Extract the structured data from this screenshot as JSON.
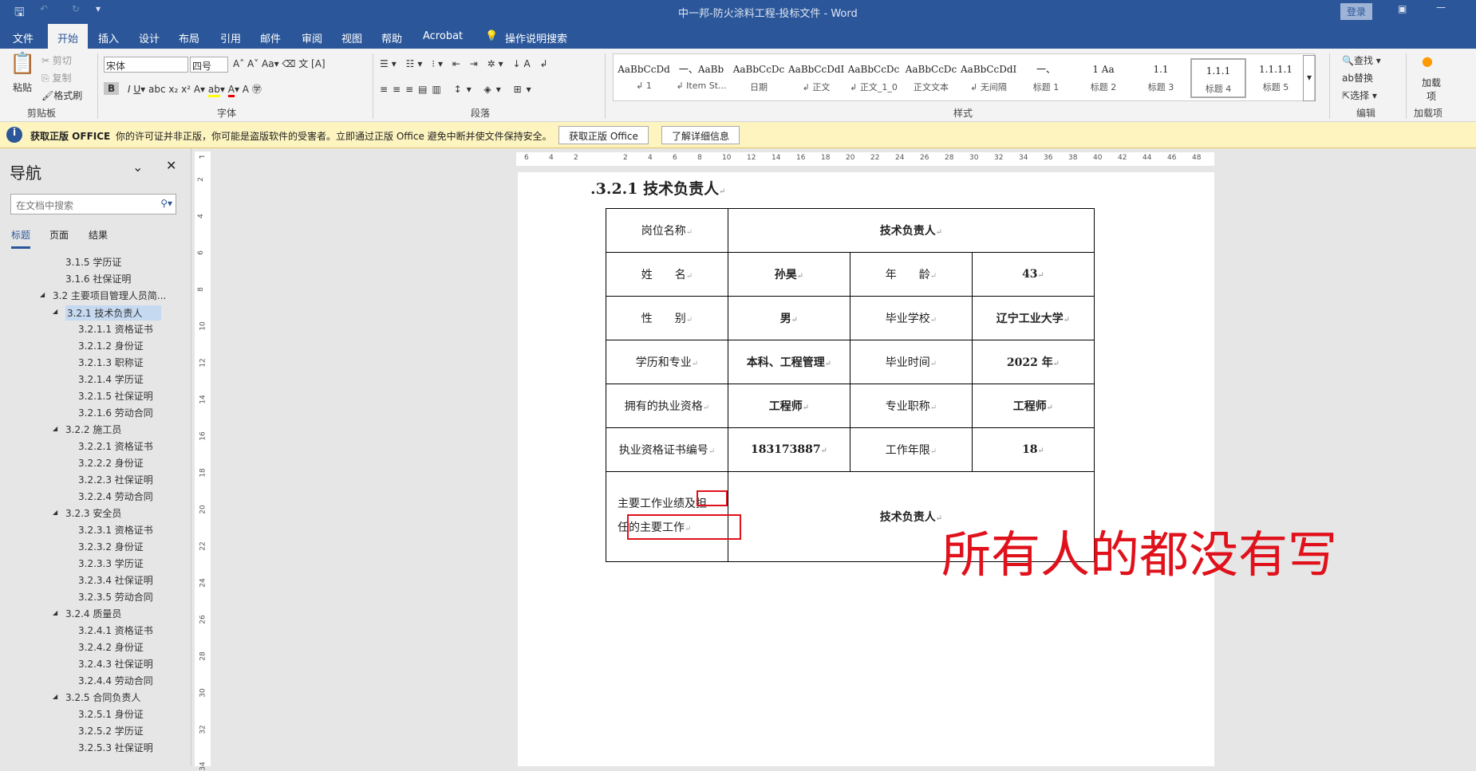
{
  "titlebar": {
    "title": "中一邦-防火涂料工程-投标文件  -  Word",
    "login": "登录"
  },
  "tabs": [
    "文件",
    "开始",
    "插入",
    "设计",
    "布局",
    "引用",
    "邮件",
    "审阅",
    "视图",
    "帮助",
    "Acrobat",
    "操作说明搜索"
  ],
  "ribbon": {
    "clipboard": {
      "paste": "粘贴",
      "cut": "剪切",
      "copy": "复制",
      "format_painter": "格式刷",
      "label": "剪贴板"
    },
    "font": {
      "name": "宋体",
      "size": "四号",
      "label": "字体"
    },
    "paragraph": {
      "label": "段落"
    },
    "styles": {
      "label": "样式",
      "items": [
        {
          "preview": "AaBbCcDd",
          "name": "↲ 1"
        },
        {
          "preview": "一、AaBb",
          "name": "↲ Item St..."
        },
        {
          "preview": "AaBbCcDc",
          "name": "日期"
        },
        {
          "preview": "AaBbCcDdI",
          "name": "↲ 正文"
        },
        {
          "preview": "AaBbCcDc",
          "name": "↲ 正文_1_0"
        },
        {
          "preview": "AaBbCcDc",
          "name": "正文文本"
        },
        {
          "preview": "AaBbCcDdI",
          "name": "↲ 无间隔"
        },
        {
          "preview": "一、",
          "name": "标题 1"
        },
        {
          "preview": "1  Aa",
          "name": "标题 2"
        },
        {
          "preview": "1.1",
          "name": "标题 3"
        },
        {
          "preview": "1.1.1",
          "name": "标题 4"
        },
        {
          "preview": "1.1.1.1",
          "name": "标题 5"
        }
      ]
    },
    "editing": {
      "find": "查找",
      "replace": "替换",
      "select": "选择",
      "label": "编辑"
    },
    "addins": {
      "button": "加载项",
      "label": "加载项"
    }
  },
  "infobar": {
    "title": "获取正版 OFFICE",
    "message": "你的许可证并非正版，你可能是盗版软件的受害者。立即通过正版 Office 避免中断并使文件保持安全。",
    "btn1": "获取正版 Office",
    "btn2": "了解详细信息"
  },
  "nav": {
    "title": "导航",
    "search_placeholder": "在文档中搜索",
    "tabs": [
      "标题",
      "页面",
      "结果"
    ],
    "items": [
      {
        "t": "3.1.5 学历证",
        "l": 2
      },
      {
        "t": "3.1.6 社保证明",
        "l": 2
      },
      {
        "t": "3.2 主要项目管理人员简...",
        "l": 1
      },
      {
        "t": "3.2.1 技术负责人",
        "l": 2
      },
      {
        "t": "3.2.1.1 资格证书",
        "l": 3
      },
      {
        "t": "3.2.1.2 身份证",
        "l": 3
      },
      {
        "t": "3.2.1.3 职称证",
        "l": 3
      },
      {
        "t": "3.2.1.4 学历证",
        "l": 3
      },
      {
        "t": "3.2.1.5 社保证明",
        "l": 3
      },
      {
        "t": "3.2.1.6 劳动合同",
        "l": 3
      },
      {
        "t": "3.2.2 施工员",
        "l": 2
      },
      {
        "t": "3.2.2.1 资格证书",
        "l": 3
      },
      {
        "t": "3.2.2.2 身份证",
        "l": 3
      },
      {
        "t": "3.2.2.3 社保证明",
        "l": 3
      },
      {
        "t": "3.2.2.4 劳动合同",
        "l": 3
      },
      {
        "t": "3.2.3 安全员",
        "l": 2
      },
      {
        "t": "3.2.3.1 资格证书",
        "l": 3
      },
      {
        "t": "3.2.3.2 身份证",
        "l": 3
      },
      {
        "t": "3.2.3.3 学历证",
        "l": 3
      },
      {
        "t": "3.2.3.4 社保证明",
        "l": 3
      },
      {
        "t": "3.2.3.5 劳动合同",
        "l": 3
      },
      {
        "t": "3.2.4 质量员",
        "l": 2
      },
      {
        "t": "3.2.4.1 资格证书",
        "l": 3
      },
      {
        "t": "3.2.4.2 身份证",
        "l": 3
      },
      {
        "t": "3.2.4.3 社保证明",
        "l": 3
      },
      {
        "t": "3.2.4.4 劳动合同",
        "l": 3
      },
      {
        "t": "3.2.5 合同负责人",
        "l": 2
      },
      {
        "t": "3.2.5.1 身份证",
        "l": 3
      },
      {
        "t": "3.2.5.2 学历证",
        "l": 3
      },
      {
        "t": "3.2.5.3 社保证明",
        "l": 3
      }
    ],
    "selected": "3.2.1 技术负责人"
  },
  "ruler": {
    "h": [
      "6",
      "4",
      "2",
      "",
      "2",
      "4",
      "6",
      "8",
      "10",
      "12",
      "14",
      "16",
      "18",
      "20",
      "22",
      "24",
      "26",
      "28",
      "30",
      "32",
      "34",
      "36",
      "38",
      "40",
      "42",
      "44",
      "46",
      "48"
    ],
    "v": [
      "2",
      "4",
      "6",
      "8",
      "10",
      "12",
      "14",
      "16",
      "18",
      "20",
      "22",
      "24",
      "26",
      "28",
      "30",
      "32",
      "34"
    ]
  },
  "doc": {
    "heading": "3.2.1 技术负责人",
    "table": {
      "post_label": "岗位名称",
      "post": "技术负责人",
      "rows": [
        [
          "姓　　名",
          "孙昊",
          "年　　龄",
          "43"
        ],
        [
          "性　　别",
          "男",
          "毕业学校",
          "辽宁工业大学"
        ],
        [
          "学历和专业",
          "本科、工程管理",
          "毕业时间",
          "2022 年"
        ],
        [
          "拥有的执业资格",
          "工程师",
          "专业职称",
          "工程师"
        ],
        [
          "执业资格证书编号",
          "183173887",
          "工作年限",
          "18"
        ]
      ],
      "work_label_1": "主要工作业绩及担",
      "work_label_2": "任的主要工作",
      "work": "技术负责人"
    }
  },
  "annotation": {
    "text": "所有人的都没有写",
    "color": "#e0111b"
  }
}
